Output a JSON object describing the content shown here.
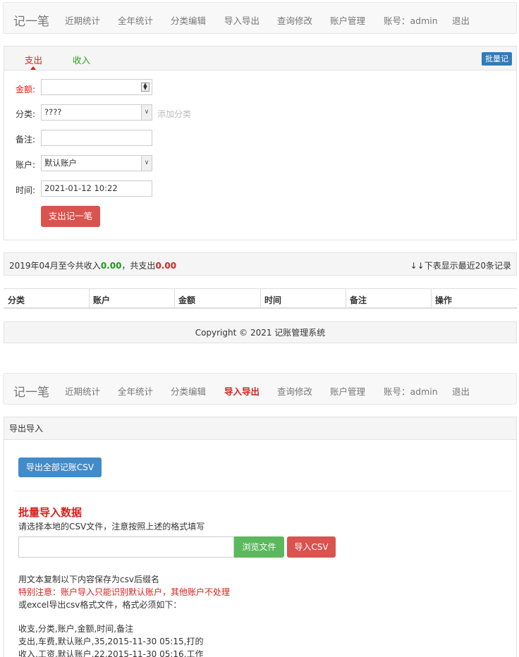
{
  "nav": {
    "brand": "记一笔",
    "items": [
      "近期统计",
      "全年统计",
      "分类编辑",
      "导入导出",
      "查询修改",
      "账户管理",
      "账号：admin",
      "退出"
    ]
  },
  "entry_form": {
    "tabs": [
      "支出",
      "收入"
    ],
    "batch_button": "批量记",
    "amount_label": "金额:",
    "amount_value": "",
    "category_label": "分类:",
    "category_value": "????",
    "add_category": "添加分类",
    "note_label": "备注:",
    "note_value": "",
    "account_label": "账户:",
    "account_value": "默认账户",
    "time_label": "时间:",
    "time_value": "2021-01-12 10:22",
    "submit_label": "支出记一笔"
  },
  "summary": {
    "prefix": "2019年04月至今共收入",
    "income": "0.00",
    "middle": "，共支出",
    "expense": "0.00",
    "right": "↓↓下表显示最近20条记录"
  },
  "table": {
    "headers": [
      "分类",
      "账户",
      "金额",
      "时间",
      "备注",
      "操作"
    ]
  },
  "footer": "Copyright © 2021 记账管理系统",
  "nav2": {
    "brand": "记一笔",
    "items": [
      "近期统计",
      "全年统计",
      "分类编辑",
      "导入导出",
      "查询修改",
      "账户管理",
      "账号：admin",
      "退出"
    ],
    "active": "导入导出"
  },
  "import_export": {
    "panel_title": "导出导入",
    "export_button": "导出全部记账CSV",
    "batch_title": "批量导入数据",
    "batch_subtitle": "请选择本地的CSV文件，注意按照上述的格式填写",
    "browse_button": "浏览文件",
    "import_button": "导入CSV",
    "notes": [
      "用文本复制以下内容保存为csv后缀名",
      "特别注意：账户导入只能识别默认账户，其他账户不处理",
      "或excel导出csv格式文件，格式必须如下：",
      "收支,分类,账户,金额,时间,备注",
      "支出,车费,默认账户,35,2015-11-30 05:15,打的",
      "收入,工资,默认账户,22,2015-11-30 05:16,工作"
    ]
  }
}
